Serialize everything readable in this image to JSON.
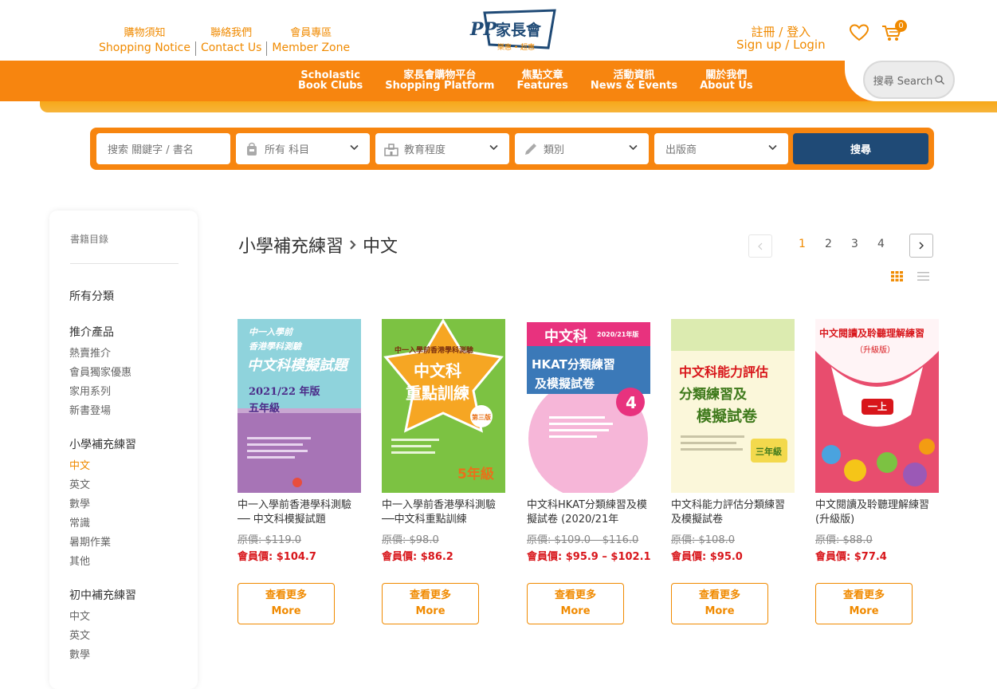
{
  "header": {
    "links": [
      {
        "zh": "購物須知",
        "en": "Shopping Notice"
      },
      {
        "zh": "聯絡我們",
        "en": "Contact Us"
      },
      {
        "zh": "會員專區",
        "en": "Member Zone"
      }
    ],
    "logo_mark": "PP",
    "logo_name": "家長會",
    "logo_tagline": "樂惠 • 超惠",
    "login_zh": "註冊 / 登入",
    "login_en": "Sign up / Login",
    "cart_count": "0"
  },
  "nav": {
    "items": [
      {
        "zh": "Scholastic",
        "en": "Book Clubs"
      },
      {
        "zh": "家長會購物平台",
        "en": "Shopping Platform"
      },
      {
        "zh": "焦點文章",
        "en": "Features"
      },
      {
        "zh": "活動資訊",
        "en": "News & Events"
      },
      {
        "zh": "關於我們",
        "en": "About Us"
      }
    ],
    "search_label": "搜尋 Search"
  },
  "filters": {
    "keyword_placeholder": "搜索 關鍵字 / 書名",
    "subject": "所有 科目",
    "level": "教育程度",
    "category": "類別",
    "publisher": "出版商",
    "submit": "搜尋"
  },
  "sidebar": {
    "title": "書籍目錄",
    "all": "所有分類",
    "section1": "推介產品",
    "section1_items": [
      "熱賣推介",
      "會員獨家優惠",
      "家用系列",
      "新書登場"
    ],
    "section2": "小學補充練習",
    "section2_items": [
      "中文",
      "英文",
      "數學",
      "常識",
      "暑期作業",
      "其他"
    ],
    "section3": "初中補充練習",
    "section3_items": [
      "中文",
      "英文",
      "數學"
    ]
  },
  "breadcrumb": {
    "parent": "小學補充練習",
    "current": "中文"
  },
  "pagination": {
    "pages": [
      "1",
      "2",
      "3",
      "4"
    ],
    "current": "1"
  },
  "colors": {
    "accent": "#f7850f",
    "price": "#d8161b",
    "submit": "#1f4a76"
  },
  "products": [
    {
      "title": "中一入學前香港學科測驗── 中文科模擬試題",
      "orig": "原價: $119.0",
      "member": "會員價: $104.7",
      "more_zh": "查看更多",
      "more_en": "More",
      "cover": {
        "line1": "中一入學前",
        "line2": "香港學科測驗",
        "line3": "中文科模擬試題",
        "line4": "2021/22 年版",
        "line5": "五年級"
      }
    },
    {
      "title": "中一入學前香港學科測驗──中文科重點訓練",
      "orig": "原價: $98.0",
      "member": "會員價: $86.2",
      "more_zh": "查看更多",
      "more_en": "More",
      "cover": {
        "line1": "中一入學前香港學科測驗",
        "line2": "中文科",
        "line3": "重點訓練",
        "line4": "第三版",
        "line5": "5年級"
      }
    },
    {
      "title": "中文科HKAT分類練習及模擬試卷 (2020/21年",
      "orig": "原價: $109.0 – $116.0",
      "member": "會員價: $95.9 – $102.1",
      "more_zh": "查看更多",
      "more_en": "More",
      "cover": {
        "line1": "中文科",
        "line2": "2020/21年版",
        "line3": "HKAT分類練習",
        "line4": "及模擬試卷",
        "line5": "4"
      }
    },
    {
      "title": "中文科能力評估分類練習及模擬試卷",
      "orig": "原價: $108.0",
      "member": "會員價: $95.0",
      "more_zh": "查看更多",
      "more_en": "More",
      "cover": {
        "line1": "中文科能力評估",
        "line2": "分類練習及",
        "line3": "模擬試卷",
        "line4": "三年級",
        "line5": ""
      }
    },
    {
      "title": "中文閱讀及聆聽理解練習(升級版)",
      "orig": "原價: $88.0",
      "member": "會員價: $77.4",
      "more_zh": "查看更多",
      "more_en": "More",
      "cover": {
        "line1": "中文閱讀及聆聽理解練習",
        "line2": "（升級版）",
        "line3": "一上",
        "line4": "",
        "line5": ""
      }
    }
  ]
}
